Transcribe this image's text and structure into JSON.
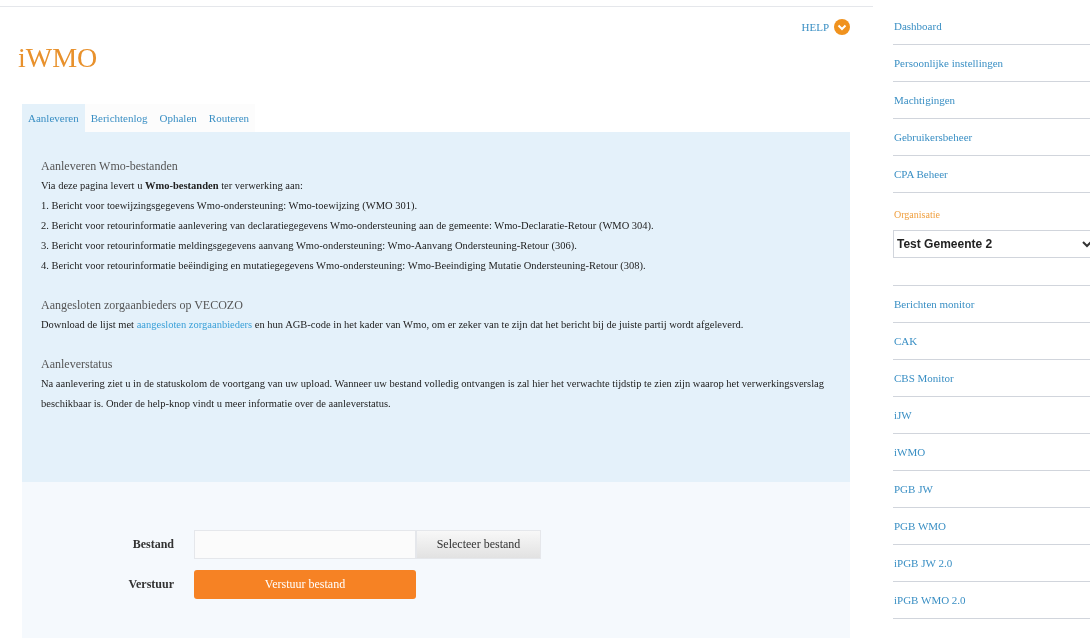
{
  "header": {
    "title": "iWMO",
    "help": "HELP"
  },
  "tabs": [
    {
      "label": "Aanleveren",
      "selected": true
    },
    {
      "label": "Berichtenlog",
      "selected": false
    },
    {
      "label": "Ophalen",
      "selected": false
    },
    {
      "label": "Routeren",
      "selected": false
    }
  ],
  "sections": [
    {
      "heading": "Aanleveren Wmo-bestanden",
      "lines": [
        "Via deze pagina levert u **Wmo-bestanden** ter verwerking aan:",
        "1. Bericht voor toewijzingsgegevens Wmo-ondersteuning: Wmo-toewijzing (WMO 301).",
        "2. Bericht voor retourinformatie aanlevering van declaratiegegevens Wmo-ondersteuning aan de gemeente: Wmo-Declaratie-Retour (WMO 304).",
        "3. Bericht voor retourinformatie meldingsgegevens aanvang Wmo-ondersteuning: Wmo-Aanvang Ondersteuning-Retour (306).",
        "4. Bericht voor retourinformatie beëindiging en mutatiegegevens Wmo-ondersteuning: Wmo-Beeindiging Mutatie Ondersteuning-Retour (308)."
      ]
    },
    {
      "heading": "Aangesloten zorgaanbieders op VECOZO",
      "paragraph": {
        "before": "Download de lijst met",
        "link": "aangesloten zorgaanbieders",
        "after": "en hun AGB-code in het kader van Wmo, om er zeker van te zijn dat het bericht bij de juiste partij wordt afgeleverd."
      }
    },
    {
      "heading": "Aanleverstatus",
      "paragraph": {
        "before": "Na aanlevering ziet u in de statuskolom de voortgang van uw upload. Wanneer uw bestand volledig ontvangen is zal hier het verwachte tijdstip te zien zijn waarop het verwerkingsverslag beschikbaar is. Onder de help-knop vindt u meer informatie over de aanleverstatus."
      }
    }
  ],
  "form": {
    "file_label": "Bestand",
    "select_button": "Selecteer bestand",
    "send_label": "Verstuur",
    "send_button": "Verstuur bestand"
  },
  "sidebar": {
    "top_items": [
      "Dashboard",
      "Persoonlijke instellingen",
      "Machtigingen",
      "Gebruikersbeheer",
      "CPA Beheer"
    ],
    "organisation_label": "Organisatie",
    "organisation_value": "Test Gemeente 2",
    "items": [
      "Berichten monitor",
      "CAK",
      "CBS Monitor",
      "iJW",
      "iWMO",
      "PGB JW",
      "PGB WMO",
      "iPGB JW 2.0",
      "iPGB WMO 2.0"
    ]
  }
}
